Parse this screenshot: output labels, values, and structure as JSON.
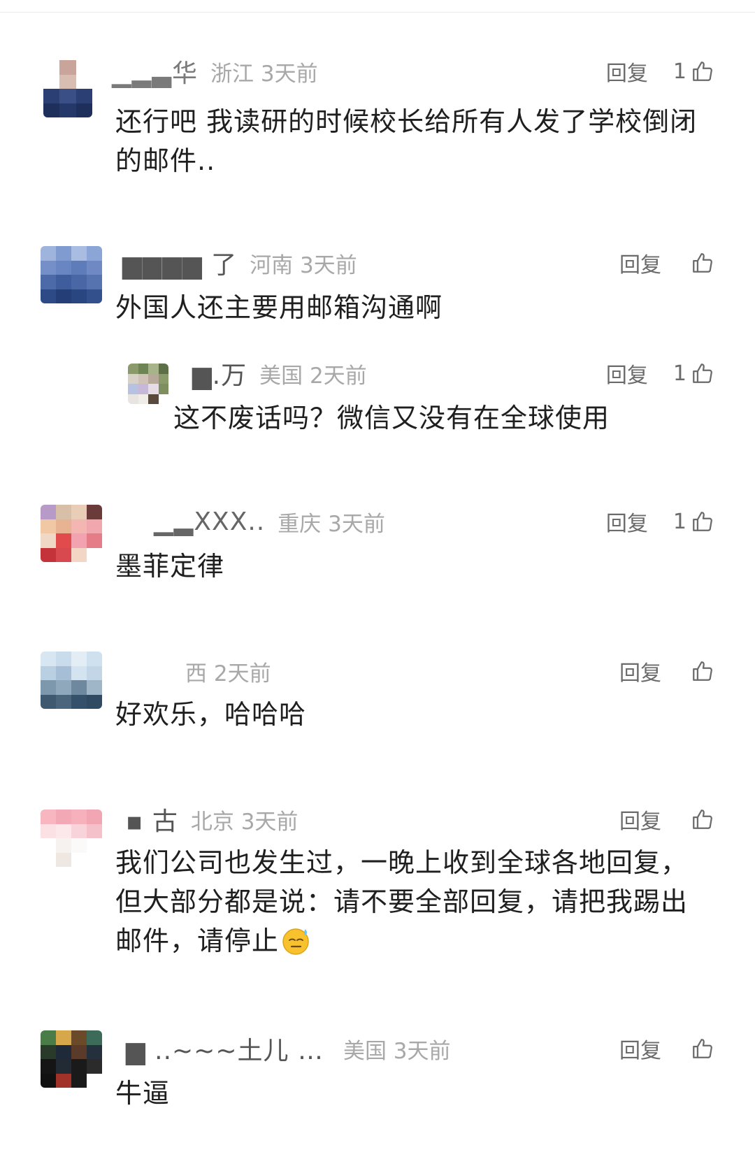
{
  "comments": [
    {
      "username": "▁▂▃华",
      "location": "浙江 3天前",
      "reply_label": "回复",
      "like_count": "1",
      "text": "还行吧 我读研的时候校长给所有人发了学校倒闭的邮件..",
      "avatar_icon": "avatar-icon",
      "replies": []
    },
    {
      "username": "▆▆▆▆ 了",
      "location": "河南 3天前",
      "reply_label": "回复",
      "like_count": "",
      "text": "外国人还主要用邮箱沟通啊",
      "avatar_icon": "avatar-icon",
      "replies": [
        {
          "username": "▆.万",
          "location": "美国 2天前",
          "reply_label": "回复",
          "like_count": "1",
          "text": "这不废话吗？微信又没有在全球使用"
        }
      ]
    },
    {
      "username": "▁▂XXX..",
      "location": "重庆 3天前",
      "reply_label": "回复",
      "like_count": "1",
      "text": "墨菲定律",
      "replies": []
    },
    {
      "username": "",
      "location": "西 2天前",
      "reply_label": "回复",
      "like_count": "",
      "text": "好欢乐，哈哈哈",
      "replies": []
    },
    {
      "username": "▪ 古",
      "location": "北京 3天前",
      "reply_label": "回复",
      "like_count": "",
      "text": "我们公司也发生过，一晚上收到全球各地回复，但大部分都是说：请不要全部回复，请把我踢出邮件，请停止",
      "emoji": "sweat-smile-emoji",
      "replies": []
    },
    {
      "username": "▆ ..~~~土儿 …",
      "location": "美国 3天前",
      "reply_label": "回复",
      "like_count": "",
      "text": "牛逼",
      "replies": []
    }
  ],
  "colors": {
    "text": "#1f1f1f",
    "meta": "#a8a8a8",
    "username": "#7a7a7a",
    "action": "#6b6b6b"
  }
}
